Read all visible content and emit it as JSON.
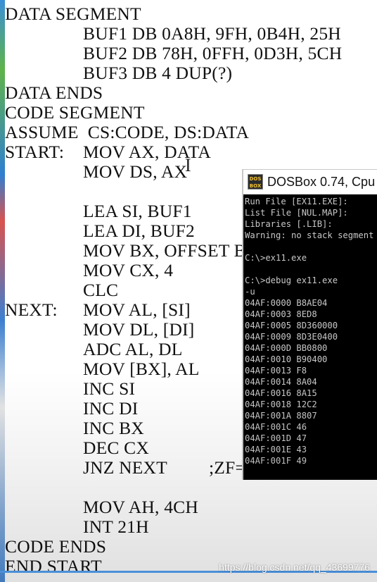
{
  "code": {
    "lines": [
      {
        "label": "DATA SEGMENT",
        "instr": "",
        "comment": ""
      },
      {
        "label": "",
        "instr": "BUF1 DB 0A8H, 9FH, 0B4H, 25H",
        "comment": ""
      },
      {
        "label": "",
        "instr": "BUF2 DB 78H, 0FFH, 0D3H, 5CH",
        "comment": ""
      },
      {
        "label": "",
        "instr": "BUF3 DB 4 DUP(?)",
        "comment": ""
      },
      {
        "label": "DATA ENDS",
        "instr": "",
        "comment": ""
      },
      {
        "label": "CODE SEGMENT",
        "instr": "",
        "comment": ""
      },
      {
        "label": "ASSUME  CS:CODE, DS:DATA",
        "instr": "",
        "comment": ""
      },
      {
        "label": "START:",
        "instr": "MOV AX, DATA",
        "comment": ""
      },
      {
        "label": "",
        "instr": "MOV DS, AX",
        "comment": ""
      },
      {
        "label": "",
        "instr": "",
        "comment": ""
      },
      {
        "label": "",
        "instr": "LEA SI, BUF1",
        "comment": ""
      },
      {
        "label": "",
        "instr": "LEA DI, BUF2",
        "comment": ""
      },
      {
        "label": "",
        "instr": "MOV BX, OFFSET B",
        "comment": ""
      },
      {
        "label": "",
        "instr": "MOV CX, 4",
        "comment": ""
      },
      {
        "label": "",
        "instr": "CLC",
        "comment": ""
      },
      {
        "label": "NEXT:",
        "instr": "MOV AL, [SI]",
        "comment": ""
      },
      {
        "label": "",
        "instr": "MOV DL, [DI]",
        "comment": ""
      },
      {
        "label": "",
        "instr": "ADC AL, DL",
        "comment": ""
      },
      {
        "label": "",
        "instr": "MOV [BX], AL",
        "comment": ""
      },
      {
        "label": "",
        "instr": "INC SI",
        "comment": ""
      },
      {
        "label": "",
        "instr": "INC DI",
        "comment": ""
      },
      {
        "label": "",
        "instr": "INC BX",
        "comment": ""
      },
      {
        "label": "",
        "instr": "DEC CX",
        "comment": ""
      },
      {
        "label": "",
        "instr": "JNZ NEXT",
        "comment": ";ZF=-"
      },
      {
        "label": "",
        "instr": "",
        "comment": ""
      },
      {
        "label": "",
        "instr": "MOV AH, 4CH",
        "comment": ""
      },
      {
        "label": "",
        "instr": "INT 21H",
        "comment": ""
      },
      {
        "label": "CODE ENDS",
        "instr": "",
        "comment": ""
      },
      {
        "label": "END START",
        "instr": "",
        "comment": ""
      }
    ]
  },
  "dosbox": {
    "title": "DOSBox 0.74, Cpu",
    "logo_text": "DOS BOX",
    "lines": [
      "Run File [EX11.EXE]:",
      "List File [NUL.MAP]:",
      "Libraries [.LIB]:",
      "Warning: no stack segment",
      "",
      "C:\\>ex11.exe",
      "",
      "C:\\>debug ex11.exe",
      "-u",
      "04AF:0000 B8AE04",
      "04AF:0003 8ED8",
      "04AF:0005 8D360000",
      "04AF:0009 8D3E0400",
      "04AF:000D BB0800",
      "04AF:0010 B90400",
      "04AF:0013 F8",
      "04AF:0014 8A04",
      "04AF:0016 8A15",
      "04AF:0018 12C2",
      "04AF:001A 8807",
      "04AF:001C 46",
      "04AF:001D 47",
      "04AF:001E 43",
      "04AF:001F 49"
    ]
  },
  "watermark": "https://blog.csdn.net/qq_43699776",
  "colors": {
    "editor_bg": "#ffffff",
    "code_text": "#111111",
    "console_bg": "#000000",
    "console_text": "#c8c8c8",
    "accent": "#4a8fd8"
  }
}
